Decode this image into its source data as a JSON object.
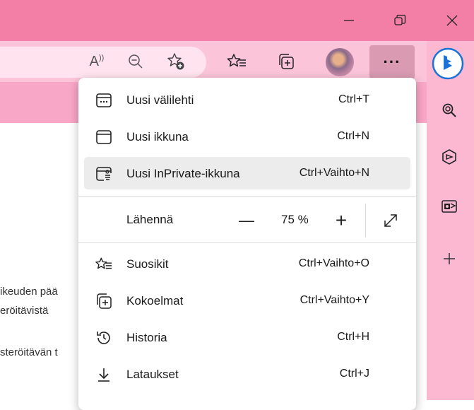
{
  "titlebar": {
    "minimize_icon": "minimize-icon",
    "restore_icon": "restore-icon",
    "close_icon": "close-icon"
  },
  "toolbar": {
    "read_aloud_label": "A",
    "zoom_out_icon": "zoom-out-icon",
    "add_favorite_icon": "add-favorite-icon",
    "favorites_icon": "favorites-icon",
    "collections_icon": "collections-icon",
    "profile_icon": "profile-avatar",
    "more_label": "···"
  },
  "page": {
    "lines": [
      "ikeuden pää",
      "eröitävistä",
      "steröitävän t"
    ]
  },
  "menu": {
    "items": [
      {
        "label": "Uusi välilehti",
        "shortcut": "Ctrl+T",
        "icon": "new-tab-icon"
      },
      {
        "label": "Uusi ikkuna",
        "shortcut": "Ctrl+N",
        "icon": "new-window-icon"
      },
      {
        "label": "Uusi InPrivate-ikkuna",
        "shortcut": "Ctrl+Vaihto+N",
        "icon": "inprivate-window-icon"
      }
    ],
    "zoom": {
      "label": "Lähennä",
      "minus": "—",
      "value": "75 %",
      "plus": "+"
    },
    "items2": [
      {
        "label": "Suosikit",
        "shortcut": "Ctrl+Vaihto+O",
        "icon": "favorites-icon"
      },
      {
        "label": "Kokoelmat",
        "shortcut": "Ctrl+Vaihto+Y",
        "icon": "collections-icon"
      },
      {
        "label": "Historia",
        "shortcut": "Ctrl+H",
        "icon": "history-icon"
      },
      {
        "label": "Lataukset",
        "shortcut": "Ctrl+J",
        "icon": "downloads-icon"
      }
    ]
  },
  "sidebar": {
    "icons": [
      "bing-chat-icon",
      "search-icon",
      "office-icon",
      "outlook-icon",
      "add-icon"
    ]
  },
  "colors": {
    "titlebar": "#f47fa6",
    "toolbar": "#fbc4d8",
    "sidebar": "#fbb8d0",
    "accent": "#1b72d6"
  }
}
